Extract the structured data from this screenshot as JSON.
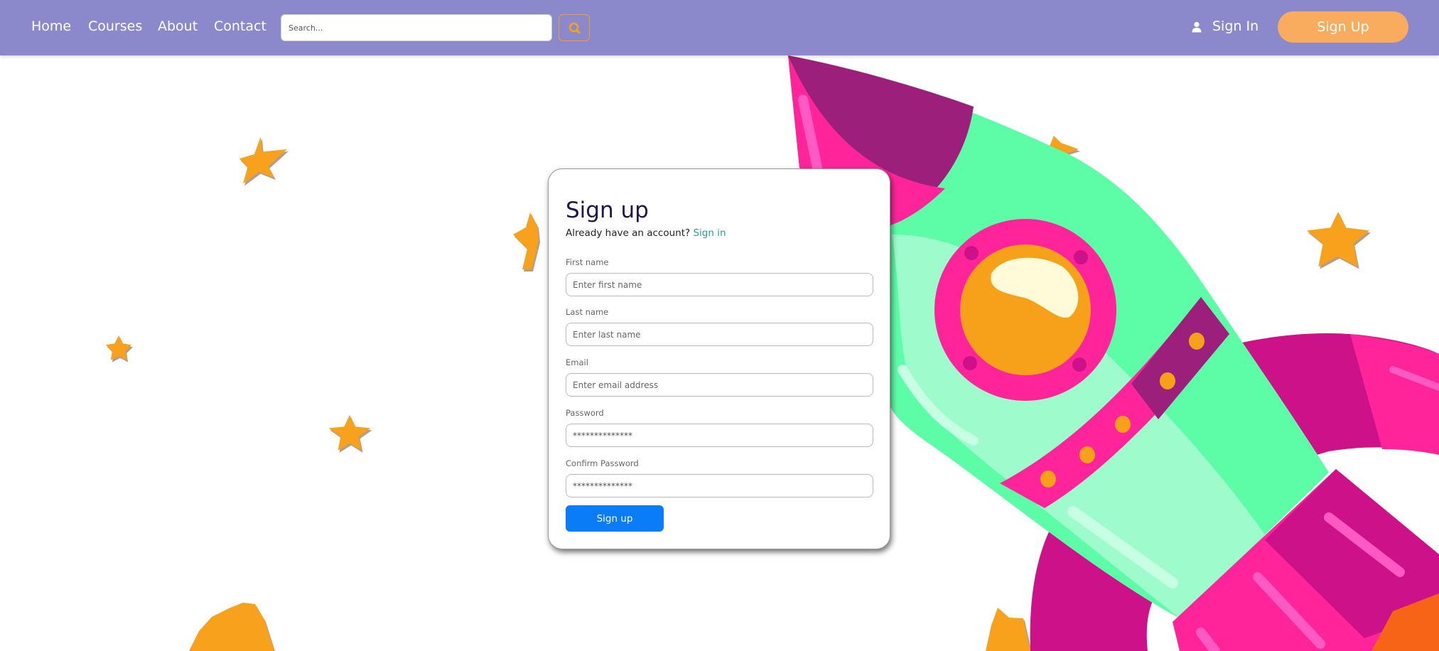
{
  "nav": {
    "links": [
      "Home",
      "Courses",
      "About",
      "Contact"
    ],
    "search_placeholder": "Search...",
    "search_icon": "search-icon",
    "signin_label": "Sign In",
    "signin_icon": "user-icon",
    "signup_label": "Sign Up"
  },
  "form": {
    "title": "Sign up",
    "account_prompt": "Already have an account?",
    "signin_link": "Sign in",
    "fields": [
      {
        "label": "First name",
        "placeholder": "Enter first name",
        "value": ""
      },
      {
        "label": "Last name",
        "placeholder": "Enter last name",
        "value": ""
      },
      {
        "label": "Email",
        "placeholder": "Enter email address",
        "value": ""
      },
      {
        "label": "Password",
        "placeholder": "",
        "value": "**************"
      },
      {
        "label": "Confirm Password",
        "placeholder": "",
        "value": "**************"
      }
    ],
    "submit_label": "Sign up"
  },
  "colors": {
    "navbar": "#8c88cc",
    "signup_button": "#f9ac5d",
    "search_accent": "#f4a21a",
    "link": "#2b9a9a",
    "submit": "#0a7cf7",
    "star": "#f7a11a",
    "rocket_body": "#5dfca6",
    "rocket_pink": "#ff2499",
    "rocket_purple": "#9c1f7c"
  }
}
